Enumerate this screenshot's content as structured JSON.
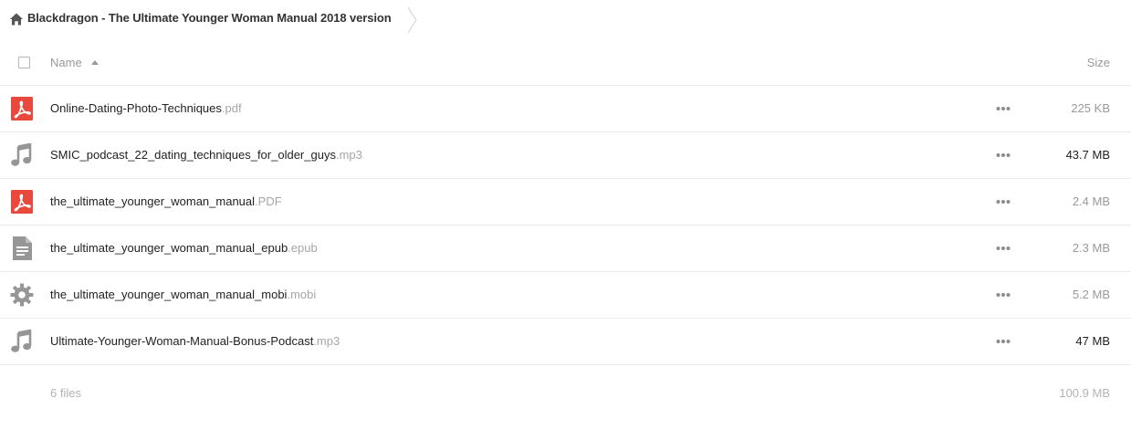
{
  "breadcrumb": {
    "home_icon": "home-icon",
    "folder_title": "Blackdragon - The Ultimate Younger Woman Manual 2018 version"
  },
  "header": {
    "name_label": "Name",
    "size_label": "Size",
    "sort_direction": "ascending"
  },
  "files": [
    {
      "name": "Online-Dating-Photo-Techniques",
      "ext": ".pdf",
      "size": "225 KB",
      "icon": "pdf-icon",
      "size_emphasis": false
    },
    {
      "name": "SMIC_podcast_22_dating_techniques_for_older_guys",
      "ext": ".mp3",
      "size": "43.7 MB",
      "icon": "music-icon",
      "size_emphasis": true
    },
    {
      "name": "the_ultimate_younger_woman_manual",
      "ext": ".PDF",
      "size": "2.4 MB",
      "icon": "pdf-icon",
      "size_emphasis": false
    },
    {
      "name": "the_ultimate_younger_woman_manual_epub",
      "ext": ".epub",
      "size": "2.3 MB",
      "icon": "document-icon",
      "size_emphasis": false
    },
    {
      "name": "the_ultimate_younger_woman_manual_mobi",
      "ext": ".mobi",
      "size": "5.2 MB",
      "icon": "gear-icon",
      "size_emphasis": false
    },
    {
      "name": "Ultimate-Younger-Woman-Manual-Bonus-Podcast",
      "ext": ".mp3",
      "size": "47 MB",
      "icon": "music-icon",
      "size_emphasis": true
    }
  ],
  "summary": {
    "count_label": "6 files",
    "total_size": "100.9 MB"
  },
  "colors": {
    "pdf_red": "#e9483c",
    "icon_gray": "#969696",
    "divider": "#ebebeb"
  }
}
